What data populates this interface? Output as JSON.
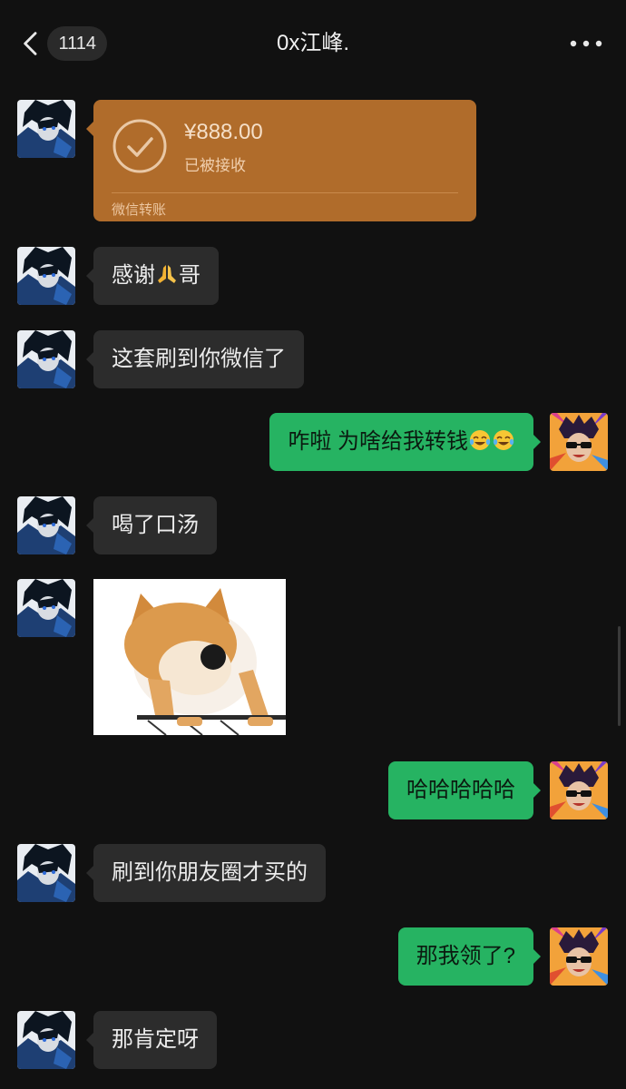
{
  "header": {
    "unread_count": "1114",
    "title": "0x江峰."
  },
  "messages": [
    {
      "side": "in",
      "type": "transfer",
      "amount": "¥888.00",
      "status": "已被接收",
      "label": "微信转账"
    },
    {
      "side": "in",
      "type": "text",
      "text_before": "感谢",
      "emoji": "folded-hands",
      "text_after": "哥"
    },
    {
      "side": "in",
      "type": "text",
      "text": "这套刷到你微信了"
    },
    {
      "side": "out",
      "type": "text",
      "text": "咋啦 为啥给我转钱",
      "emoji": "laughing-tears"
    },
    {
      "side": "in",
      "type": "text",
      "text": "喝了口汤"
    },
    {
      "side": "in",
      "type": "sticker",
      "sticker": "shiba-dog-sticker"
    },
    {
      "side": "out",
      "type": "text",
      "text": "哈哈哈哈哈"
    },
    {
      "side": "in",
      "type": "text",
      "text": "刷到你朋友圈才买的"
    },
    {
      "side": "out",
      "type": "text",
      "text": "那我领了?"
    },
    {
      "side": "in",
      "type": "text",
      "text": "那肯定呀"
    }
  ],
  "colors": {
    "background": "#111111",
    "incoming_bubble": "#2c2c2c",
    "outgoing_bubble": "#26b362",
    "transfer_card": "#b06c2b"
  }
}
